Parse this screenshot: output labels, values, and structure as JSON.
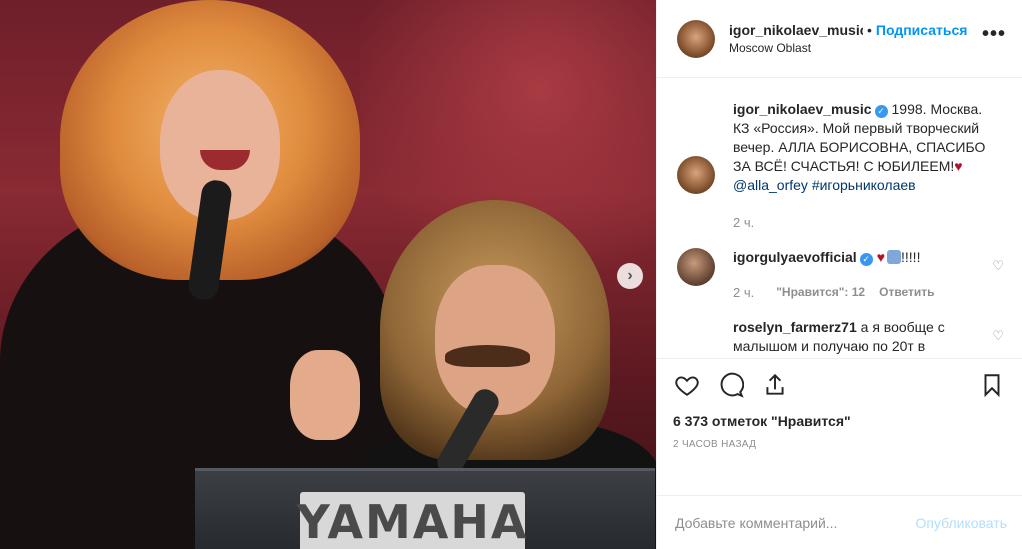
{
  "photo": {
    "brand_text": "YAMAHA"
  },
  "header": {
    "username": "igor_nikolaev_music",
    "separator": "•",
    "follow_label": "Подписаться",
    "location": "Moscow Oblast",
    "more_label": "•••"
  },
  "caption": {
    "username": "igor_nikolaev_music",
    "text": "1998. Москва. КЗ «Россия». Мой первый творческий вечер. АЛЛА БОРИСОВНА, СПАСИБО ЗА ВСЁ! СЧАСТЬЯ! С ЮБИЛЕЕМ!",
    "heart": "♥",
    "mention": "@alla_orfey",
    "hashtag": "#игорьниколаев",
    "time": "2 ч."
  },
  "comments": [
    {
      "username": "igorgulyaevofficial",
      "text": "!!!!!",
      "heart": "♥",
      "time": "2 ч.",
      "likes": "\"Нравится\": 12",
      "reply": "Ответить"
    },
    {
      "username": "roselyn_farmerz71",
      "text": "а я вообще с малышом и получаю по 20т в"
    }
  ],
  "actions": {
    "likes_count": "6 373 отметок \"Нравится\"",
    "post_time": "2 ЧАСОВ НАЗАД"
  },
  "add_comment": {
    "placeholder": "Добавьте комментарий...",
    "publish_label": "Опубликовать"
  },
  "colors": {
    "accent": "#0095f6",
    "publish_disabled": "#b2dffc",
    "verified": "#3897f0",
    "heart": "#b3122b"
  },
  "icons": [
    "next-icon",
    "heart-icon",
    "comment-icon",
    "share-icon",
    "bookmark-icon",
    "verified-icon",
    "more-icon"
  ]
}
